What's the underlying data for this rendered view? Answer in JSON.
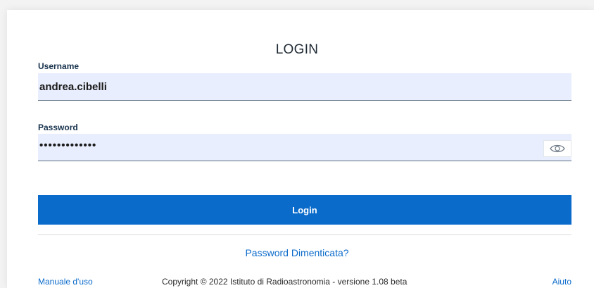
{
  "login": {
    "title": "LOGIN",
    "username": {
      "label": "Username",
      "value": "andrea.cibelli"
    },
    "password": {
      "label": "Password",
      "masked_value": "•••••••••••••",
      "toggle_icon": "eye-icon"
    },
    "submit_label": "Login",
    "forgot_link": "Password Dimenticata?"
  },
  "footer": {
    "manual_link": "Manuale d'uso",
    "copyright": "Copyright © 2022 Istituto di Radioastronomia - versione 1.08 beta",
    "help_link": "Aiuto"
  },
  "colors": {
    "accent": "#0b6bcb",
    "field_background": "#e9eefe"
  }
}
